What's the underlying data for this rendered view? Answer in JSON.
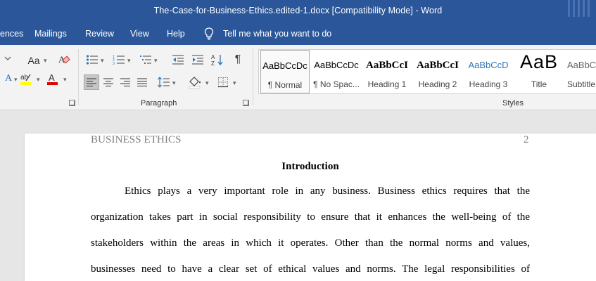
{
  "window": {
    "title": "The-Case-for-Business-Ethics.edited-1.docx [Compatibility Mode]  -  Word"
  },
  "tabs": [
    {
      "label": "ences"
    },
    {
      "label": "Mailings"
    },
    {
      "label": "Review"
    },
    {
      "label": "View"
    },
    {
      "label": "Help"
    }
  ],
  "tell_me": {
    "label": "Tell me what you want to do"
  },
  "ribbon": {
    "font_group": {
      "change_case_label": "Aa"
    },
    "paragraph_group": {
      "label": "Paragraph",
      "sort_label": "A↓Z",
      "show_marks_label": "¶"
    },
    "styles_group": {
      "label": "Styles",
      "items": [
        {
          "sample": "AaBbCcDc",
          "name": "¶ Normal",
          "selected": true
        },
        {
          "sample": "AaBbCcDc",
          "name": "¶ No Spac..."
        },
        {
          "sample": "AaBbCcI",
          "name": "Heading 1"
        },
        {
          "sample": "AaBbCcI",
          "name": "Heading 2"
        },
        {
          "sample": "AaBbCcD",
          "name": "Heading 3"
        },
        {
          "sample": "AaB",
          "name": "Title"
        },
        {
          "sample": "AaBbCc",
          "name": "Subtitle"
        }
      ]
    },
    "colors": {
      "highlight": "#ffff00",
      "font_color": "#e00000",
      "ribbon_blue": "#2b579a"
    }
  },
  "document": {
    "header_left": "BUSINESS ETHICS",
    "page_number": "2",
    "heading": "Introduction",
    "lines": [
      "Ethics plays a very important role in any business. Business ethics requires that the",
      "organization takes part in social responsibility to ensure that it enhances the well-being of the",
      "stakeholders within the areas in which it operates. Other than the normal norms and values,",
      "businesses need to have a clear set of ethical values and norms. The legal responsibilities of"
    ]
  }
}
